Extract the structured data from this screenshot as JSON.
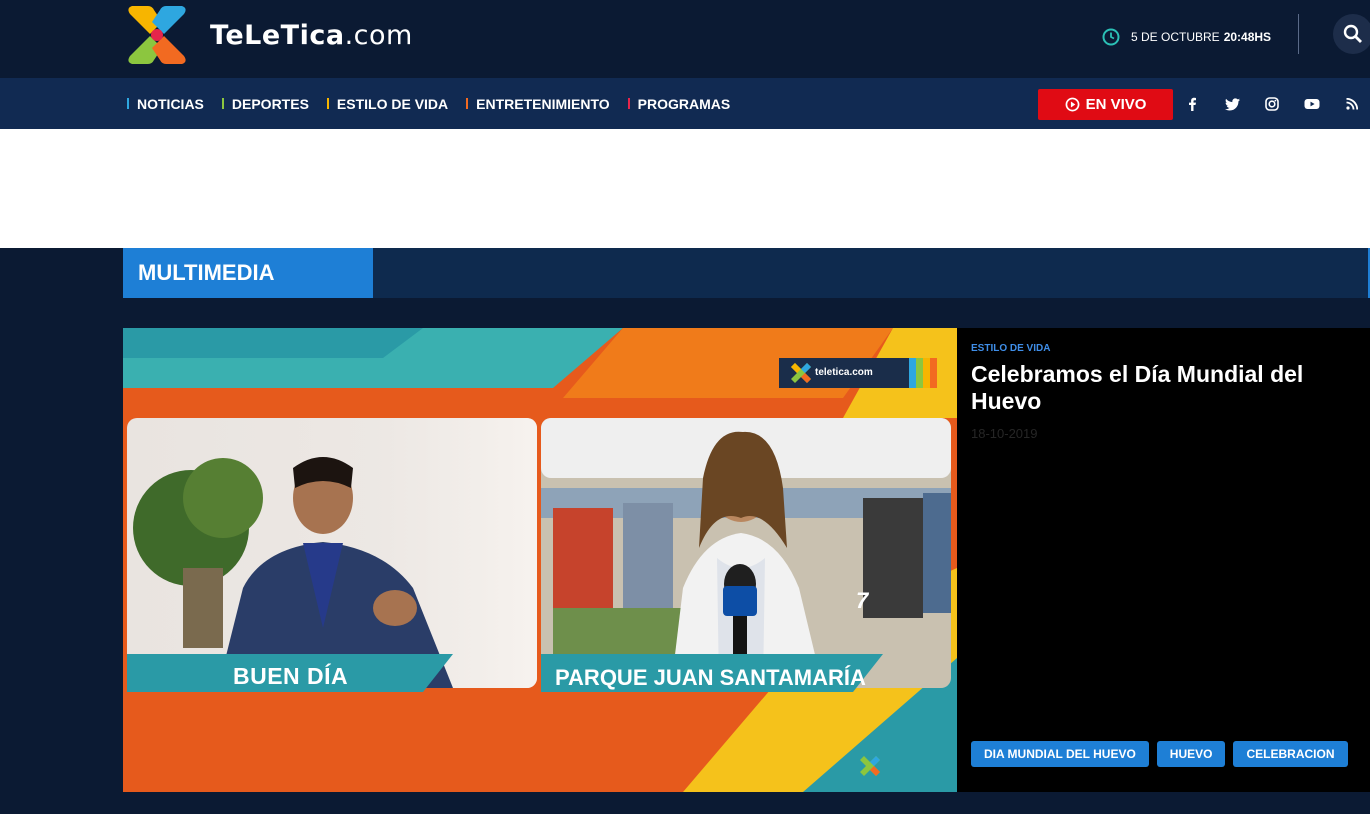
{
  "header": {
    "logo_text_bold": "TeLeTica",
    "logo_text_domain": ".com",
    "date": "5 DE OCTUBRE",
    "time": "20:48HS"
  },
  "nav": {
    "items": [
      {
        "label": "NOTICIAS",
        "color": "#2ea7e0"
      },
      {
        "label": "DEPORTES",
        "color": "#8cc63f"
      },
      {
        "label": "ESTILO DE VIDA",
        "color": "#f7b500"
      },
      {
        "label": "ENTRETENIMIENTO",
        "color": "#f26a21"
      },
      {
        "label": "PROGRAMAS",
        "color": "#e6254b"
      }
    ],
    "live_label": "EN VIVO",
    "social_icons": [
      "facebook-icon",
      "twitter-icon",
      "instagram-icon",
      "youtube-icon",
      "rss-icon"
    ]
  },
  "section": {
    "title": "MULTIMEDIA"
  },
  "feature": {
    "category": "ESTILO DE VIDA",
    "headline": "Celebramos el Día Mundial del Huevo",
    "date": "18-10-2019",
    "tags": [
      "DIA MUNDIAL DEL HUEVO",
      "HUEVO",
      "CELEBRACION"
    ],
    "video": {
      "left_caption": "BUEN DÍA",
      "right_caption": "PARQUE JUAN SANTAMARÍA",
      "bug_text": "teletica.com",
      "mic_number": "7"
    }
  },
  "colors": {
    "page_bg": "#0b1a33",
    "nav_bg": "#112a52",
    "accent_blue": "#1e7fd6",
    "live_red": "#e00b14"
  }
}
